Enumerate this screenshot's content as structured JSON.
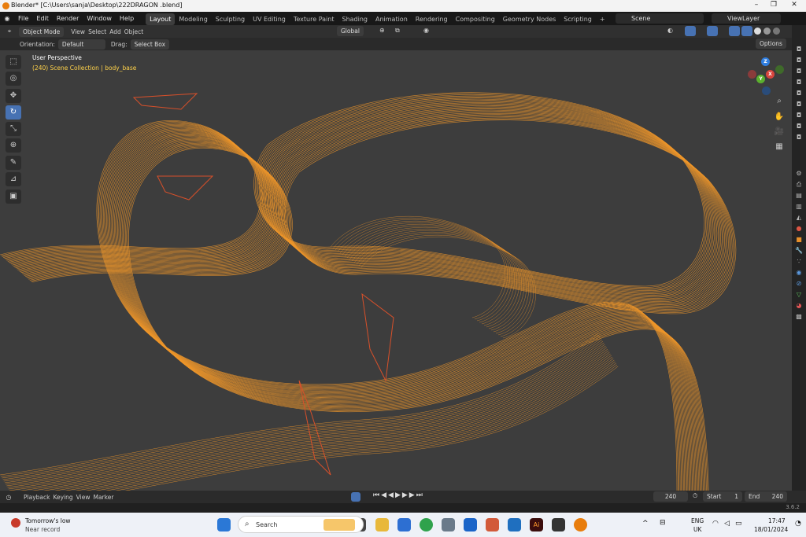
{
  "window": {
    "title": "Blender* [C:\\Users\\sanja\\Desktop\\222DRAGON .blend]",
    "controls": [
      "–",
      "❐",
      "✕"
    ]
  },
  "menubar": {
    "menus": [
      "File",
      "Edit",
      "Render",
      "Window",
      "Help"
    ],
    "workspaces": [
      "Layout",
      "Modeling",
      "Sculpting",
      "UV Editing",
      "Texture Paint",
      "Shading",
      "Animation",
      "Rendering",
      "Compositing",
      "Geometry Nodes",
      "Scripting"
    ],
    "active_workspace": "Layout",
    "add_tab": "+",
    "scene_label": "Scene",
    "viewlayer_label": "ViewLayer"
  },
  "header": {
    "mode": "Object Mode",
    "menus": [
      "View",
      "Select",
      "Add",
      "Object"
    ],
    "transform": "Global"
  },
  "header2": {
    "orientation_label": "Orientation:",
    "orientation_value": "Default",
    "drag_label": "Drag:",
    "drag_value": "Select Box",
    "options_label": "Options"
  },
  "viewport": {
    "perspective": "User Perspective",
    "collection": "(240) Scene Collection | body_base",
    "gizmo": {
      "x": "X",
      "y": "Y",
      "z": "Z"
    },
    "wire_color": "#f0962a",
    "background": "#3d3d3d"
  },
  "toolbar": {
    "tools": [
      "select-box",
      "cursor",
      "move",
      "rotate",
      "scale",
      "transform",
      "annotate",
      "measure",
      "add-cube"
    ],
    "active_tool": "rotate"
  },
  "timeline": {
    "menus": [
      "Playback",
      "Keying",
      "View",
      "Marker"
    ],
    "current_frame": "240",
    "start_label": "Start",
    "start_value": "1",
    "end_label": "End",
    "end_value": "240"
  },
  "status": {
    "version": "3.6.2"
  },
  "taskbar": {
    "weather_title": "Tomorrow's low",
    "weather_sub": "Near record",
    "search_placeholder": "Search",
    "lang": "ENG",
    "region": "UK",
    "time": "17:47",
    "date": "18/01/2024"
  }
}
